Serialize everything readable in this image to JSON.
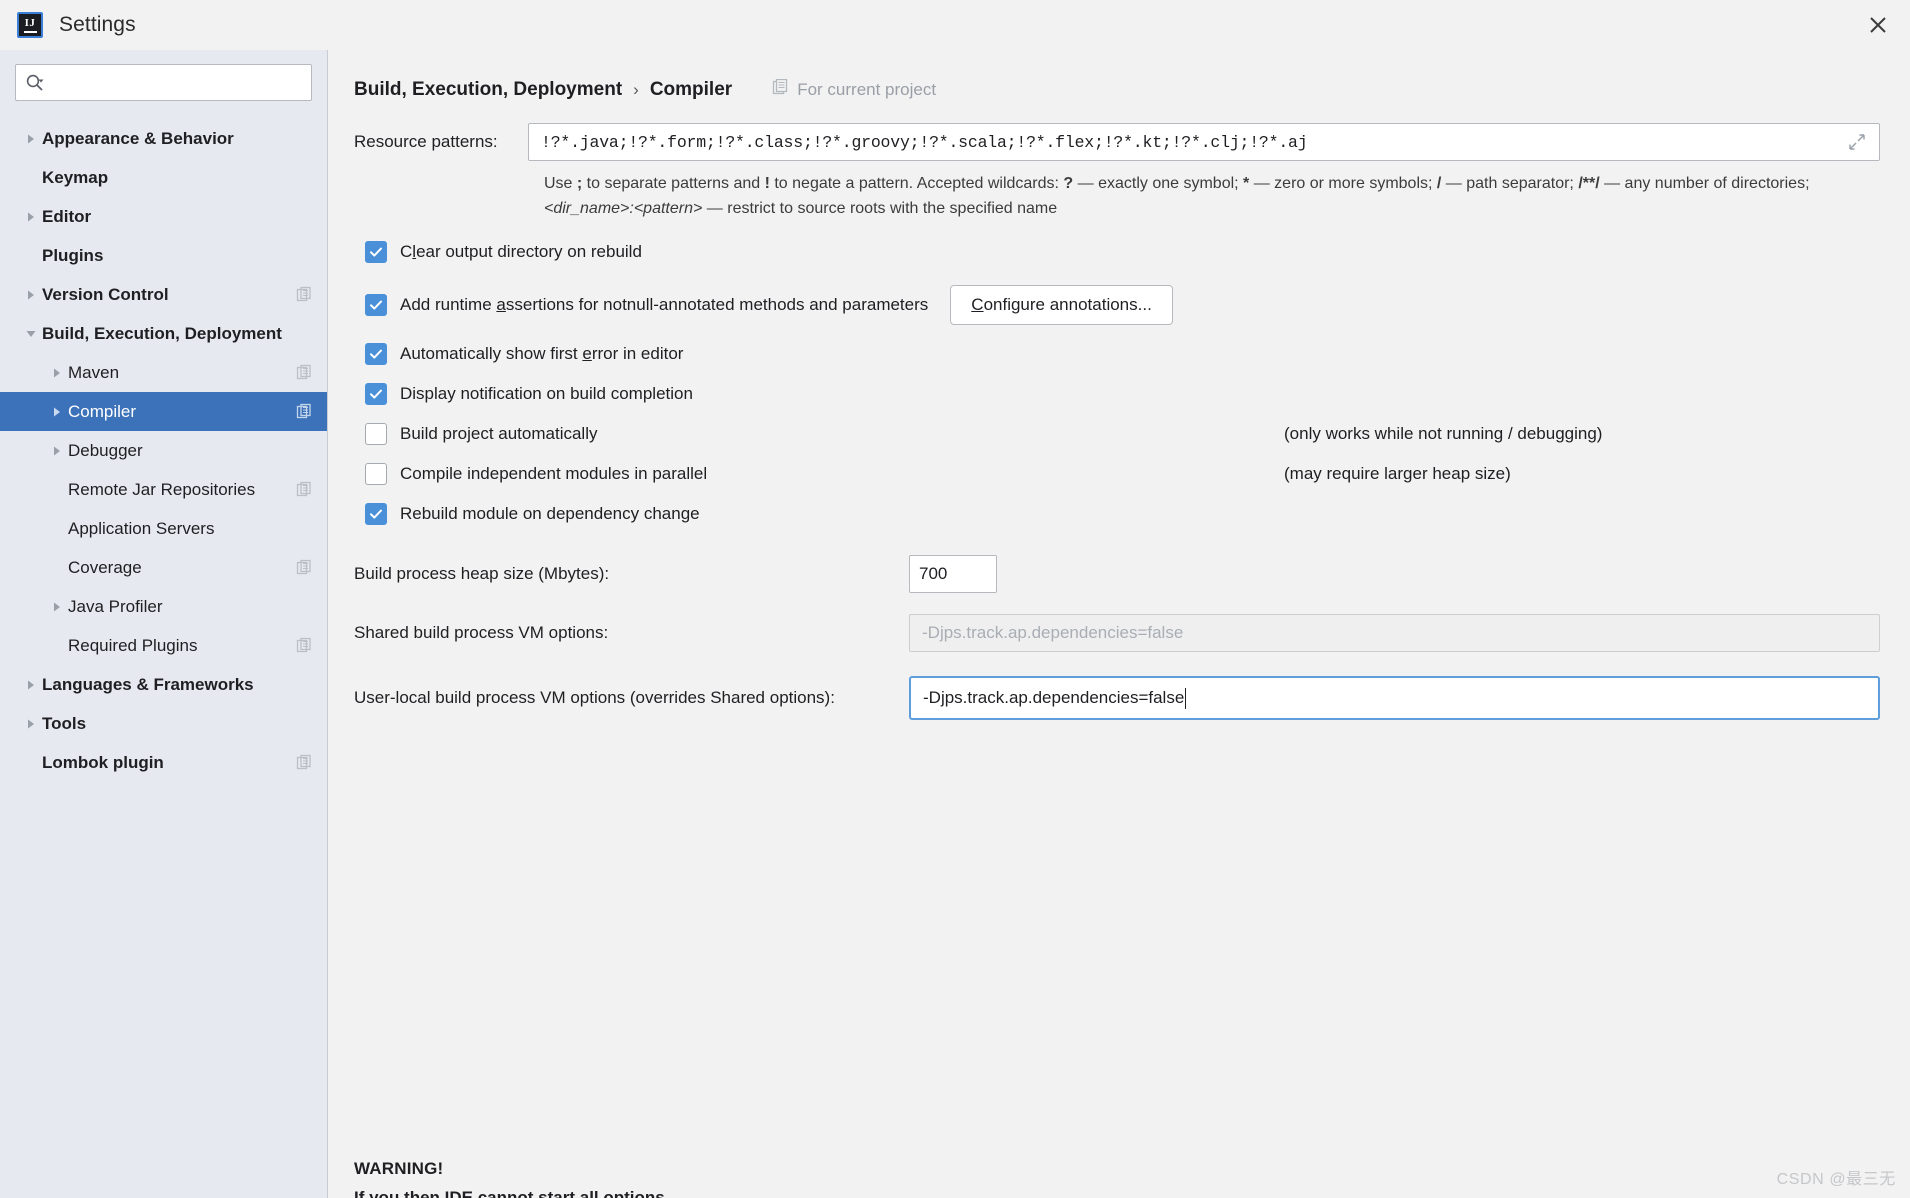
{
  "window": {
    "title": "Settings",
    "logo_icon": "intellij-idea-logo",
    "close_icon": "close-icon"
  },
  "sidebar": {
    "search": {
      "placeholder": "",
      "value": "",
      "icon": "search-icon",
      "dropdown_icon": "chevron-down-icon"
    },
    "items": [
      {
        "label": "Appearance & Behavior",
        "depth": 0,
        "arrow": "collapsed",
        "bold": true,
        "project_icon": false,
        "selected": false
      },
      {
        "label": "Keymap",
        "depth": 0,
        "arrow": "none",
        "bold": true,
        "project_icon": false,
        "selected": false
      },
      {
        "label": "Editor",
        "depth": 0,
        "arrow": "collapsed",
        "bold": true,
        "project_icon": false,
        "selected": false
      },
      {
        "label": "Plugins",
        "depth": 0,
        "arrow": "none",
        "bold": true,
        "project_icon": false,
        "selected": false
      },
      {
        "label": "Version Control",
        "depth": 0,
        "arrow": "collapsed",
        "bold": true,
        "project_icon": true,
        "selected": false
      },
      {
        "label": "Build, Execution, Deployment",
        "depth": 0,
        "arrow": "expanded",
        "bold": true,
        "project_icon": false,
        "selected": false
      },
      {
        "label": "Maven",
        "depth": 1,
        "arrow": "collapsed",
        "bold": false,
        "project_icon": true,
        "selected": false
      },
      {
        "label": "Compiler",
        "depth": 1,
        "arrow": "collapsed",
        "bold": false,
        "project_icon": true,
        "selected": true
      },
      {
        "label": "Debugger",
        "depth": 1,
        "arrow": "collapsed",
        "bold": false,
        "project_icon": false,
        "selected": false
      },
      {
        "label": "Remote Jar Repositories",
        "depth": 1,
        "arrow": "none",
        "bold": false,
        "project_icon": true,
        "selected": false
      },
      {
        "label": "Application Servers",
        "depth": 1,
        "arrow": "none",
        "bold": false,
        "project_icon": false,
        "selected": false
      },
      {
        "label": "Coverage",
        "depth": 1,
        "arrow": "none",
        "bold": false,
        "project_icon": true,
        "selected": false
      },
      {
        "label": "Java Profiler",
        "depth": 1,
        "arrow": "collapsed",
        "bold": false,
        "project_icon": false,
        "selected": false
      },
      {
        "label": "Required Plugins",
        "depth": 1,
        "arrow": "none",
        "bold": false,
        "project_icon": true,
        "selected": false
      },
      {
        "label": "Languages & Frameworks",
        "depth": 0,
        "arrow": "collapsed",
        "bold": true,
        "project_icon": false,
        "selected": false
      },
      {
        "label": "Tools",
        "depth": 0,
        "arrow": "collapsed",
        "bold": true,
        "project_icon": false,
        "selected": false
      },
      {
        "label": "Lombok plugin",
        "depth": 0,
        "arrow": "none",
        "bold": true,
        "project_icon": true,
        "selected": false
      }
    ]
  },
  "main": {
    "breadcrumb": {
      "root": "Build, Execution, Deployment",
      "separator": "›",
      "current": "Compiler",
      "scope_badge": "For current project",
      "scope_icon": "project-scope-icon"
    },
    "resource_patterns": {
      "label": "Resource patterns:",
      "value": "!?*.java;!?*.form;!?*.class;!?*.groovy;!?*.scala;!?*.flex;!?*.kt;!?*.clj;!?*.aj",
      "expand_icon": "expand-editor-icon"
    },
    "help_text": {
      "part1": "Use ",
      "sep_char": ";",
      "part2": " to separate patterns and ",
      "neg_char": "!",
      "part3": " to negate a pattern. Accepted wildcards: ",
      "q_char": "?",
      "part4": " — exactly one symbol; ",
      "star_char": "*",
      "part5": " — zero or more symbols; ",
      "slash_char": "/",
      "part6": " — path separator; ",
      "dirs_char": "/**/",
      "part7": " — any number of directories; ",
      "dirname_token": "<dir_name>:<pattern>",
      "part8": " — restrict to source roots with the specified name"
    },
    "checkboxes": [
      {
        "label_before": "C",
        "mnemonic": "l",
        "label_after": "ear output directory on rebuild",
        "checked": true,
        "hint": ""
      },
      {
        "label_before": "Add runtime ",
        "mnemonic": "a",
        "label_after": "ssertions for notnull-annotated methods and parameters",
        "checked": true,
        "hint": ""
      },
      {
        "label_before": "Automatically show first ",
        "mnemonic": "e",
        "label_after": "rror in editor",
        "checked": true,
        "hint": ""
      },
      {
        "label_before": "Display notification on build completion",
        "mnemonic": "",
        "label_after": "",
        "checked": true,
        "hint": ""
      },
      {
        "label_before": "Build project automatically",
        "mnemonic": "",
        "label_after": "",
        "checked": false,
        "hint": "(only works while not running / debugging)"
      },
      {
        "label_before": "Compile independent modules in parallel",
        "mnemonic": "",
        "label_after": "",
        "checked": false,
        "hint": "(may require larger heap size)"
      },
      {
        "label_before": "Rebuild module on dependency change",
        "mnemonic": "",
        "label_after": "",
        "checked": true,
        "hint": ""
      }
    ],
    "configure_annotations_button": {
      "label_before": "C",
      "mnemonic": "C",
      "label_after": "onfigure annotations..."
    },
    "heap": {
      "label": "Build process heap size (Mbytes):",
      "value": "700"
    },
    "shared_vm": {
      "label": "Shared build process VM options:",
      "value": "-Djps.track.ap.dependencies=false",
      "disabled": true
    },
    "user_vm": {
      "label": "User-local build process VM options (overrides Shared options):",
      "value": "-Djps.track.ap.dependencies=false",
      "focused": true
    },
    "warning": {
      "title": "WARNING!",
      "line2": "If you then IDE cannot start all options..."
    }
  },
  "watermark": "CSDN @最三无",
  "colors": {
    "selection_blue": "#3c72b9",
    "checkbox_blue": "#4a90d9",
    "focus_border": "#5f9ddb",
    "sidebar_bg": "#e6eaf0",
    "content_bg": "#f2f2f2"
  }
}
